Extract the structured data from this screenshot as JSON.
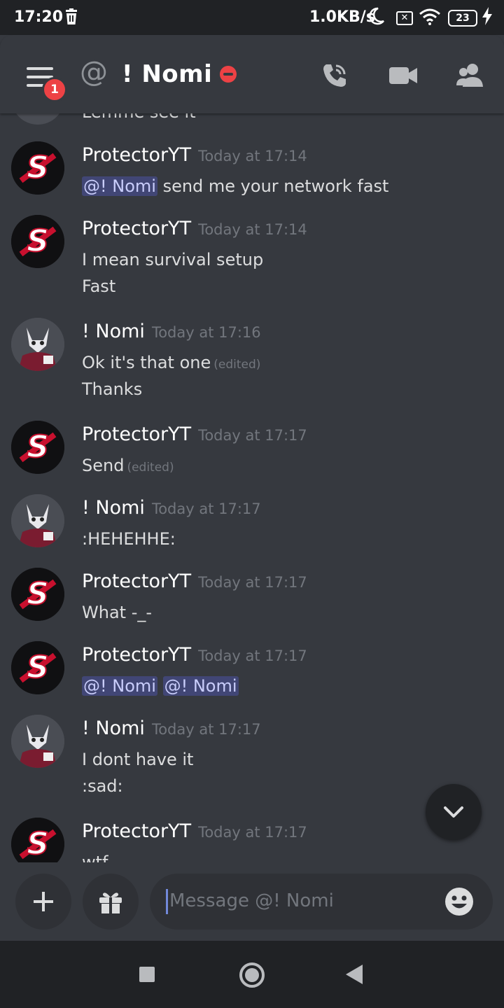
{
  "status_bar": {
    "time": "17:20",
    "network_speed": "1.0KB/s",
    "battery": "23"
  },
  "header": {
    "title": "! Nomi",
    "notification_count": "1",
    "status_color": "#ed4245"
  },
  "partial_top_line": "Lemme see it",
  "messages": [
    {
      "author": "ProtectorYT",
      "time": "Today at 17:14",
      "mention": "@! Nomi",
      "text": " send me your network fast"
    },
    {
      "author": "ProtectorYT",
      "time": "Today at 17:14",
      "lines": [
        "I mean survival setup",
        "Fast"
      ]
    },
    {
      "author": "! Nomi",
      "time": "Today at 17:16",
      "lines": [
        "Ok it's that one",
        "Thanks"
      ],
      "edited": "(edited)"
    },
    {
      "author": "ProtectorYT",
      "time": "Today at 17:17",
      "lines": [
        "Send"
      ],
      "edited": "(edited)"
    },
    {
      "author": "! Nomi",
      "time": "Today at 17:17",
      "lines": [
        ":HEHEHHE:"
      ]
    },
    {
      "author": "ProtectorYT",
      "time": "Today at 17:17",
      "lines": [
        "What -_-"
      ]
    },
    {
      "author": "ProtectorYT",
      "time": "Today at 17:17",
      "mentions": [
        "@! Nomi",
        "@! Nomi"
      ]
    },
    {
      "author": "! Nomi",
      "time": "Today at 17:17",
      "lines": [
        "I dont have it",
        ":sad:"
      ]
    },
    {
      "author": "ProtectorYT",
      "time": "Today at 17:17",
      "lines": [
        "wtf"
      ]
    }
  ],
  "composer": {
    "placeholder": "Message @! Nomi"
  },
  "colors": {
    "background": "#36393f",
    "mention_bg": "#414675",
    "mention_text": "#c9cdfb",
    "dnd": "#ed4245"
  }
}
